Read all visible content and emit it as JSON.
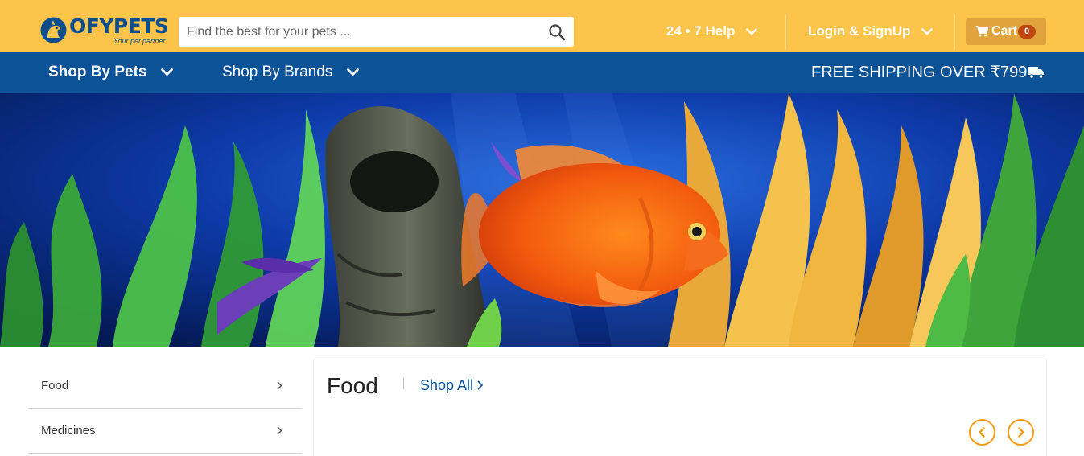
{
  "brand": {
    "name": "OFYPETS",
    "tagline": "Your pet partner",
    "primary_color": "#0c4e8c",
    "header_color": "#fdc44c",
    "nav_color": "#0c5296",
    "accent_color": "#f39c12"
  },
  "search": {
    "placeholder": "Find the best for your pets ...",
    "value": "",
    "icon": "search-icon"
  },
  "header": {
    "help_label": "24 • 7 Help",
    "login_label": "Login & SignUp",
    "cart_label": "Cart",
    "cart_count": "0"
  },
  "nav": {
    "shop_by_pets": "Shop By Pets",
    "shop_by_brands": "Shop By Brands",
    "shipping_text": "FREE SHIPPING OVER ₹799",
    "shipping_icon": "truck-icon"
  },
  "hero": {
    "image": "aquarium-banner-with-orange-fish"
  },
  "sidebar": {
    "items": [
      {
        "label": "Food"
      },
      {
        "label": "Medicines"
      }
    ]
  },
  "section": {
    "title": "Food",
    "shop_all_label": "Shop All"
  }
}
